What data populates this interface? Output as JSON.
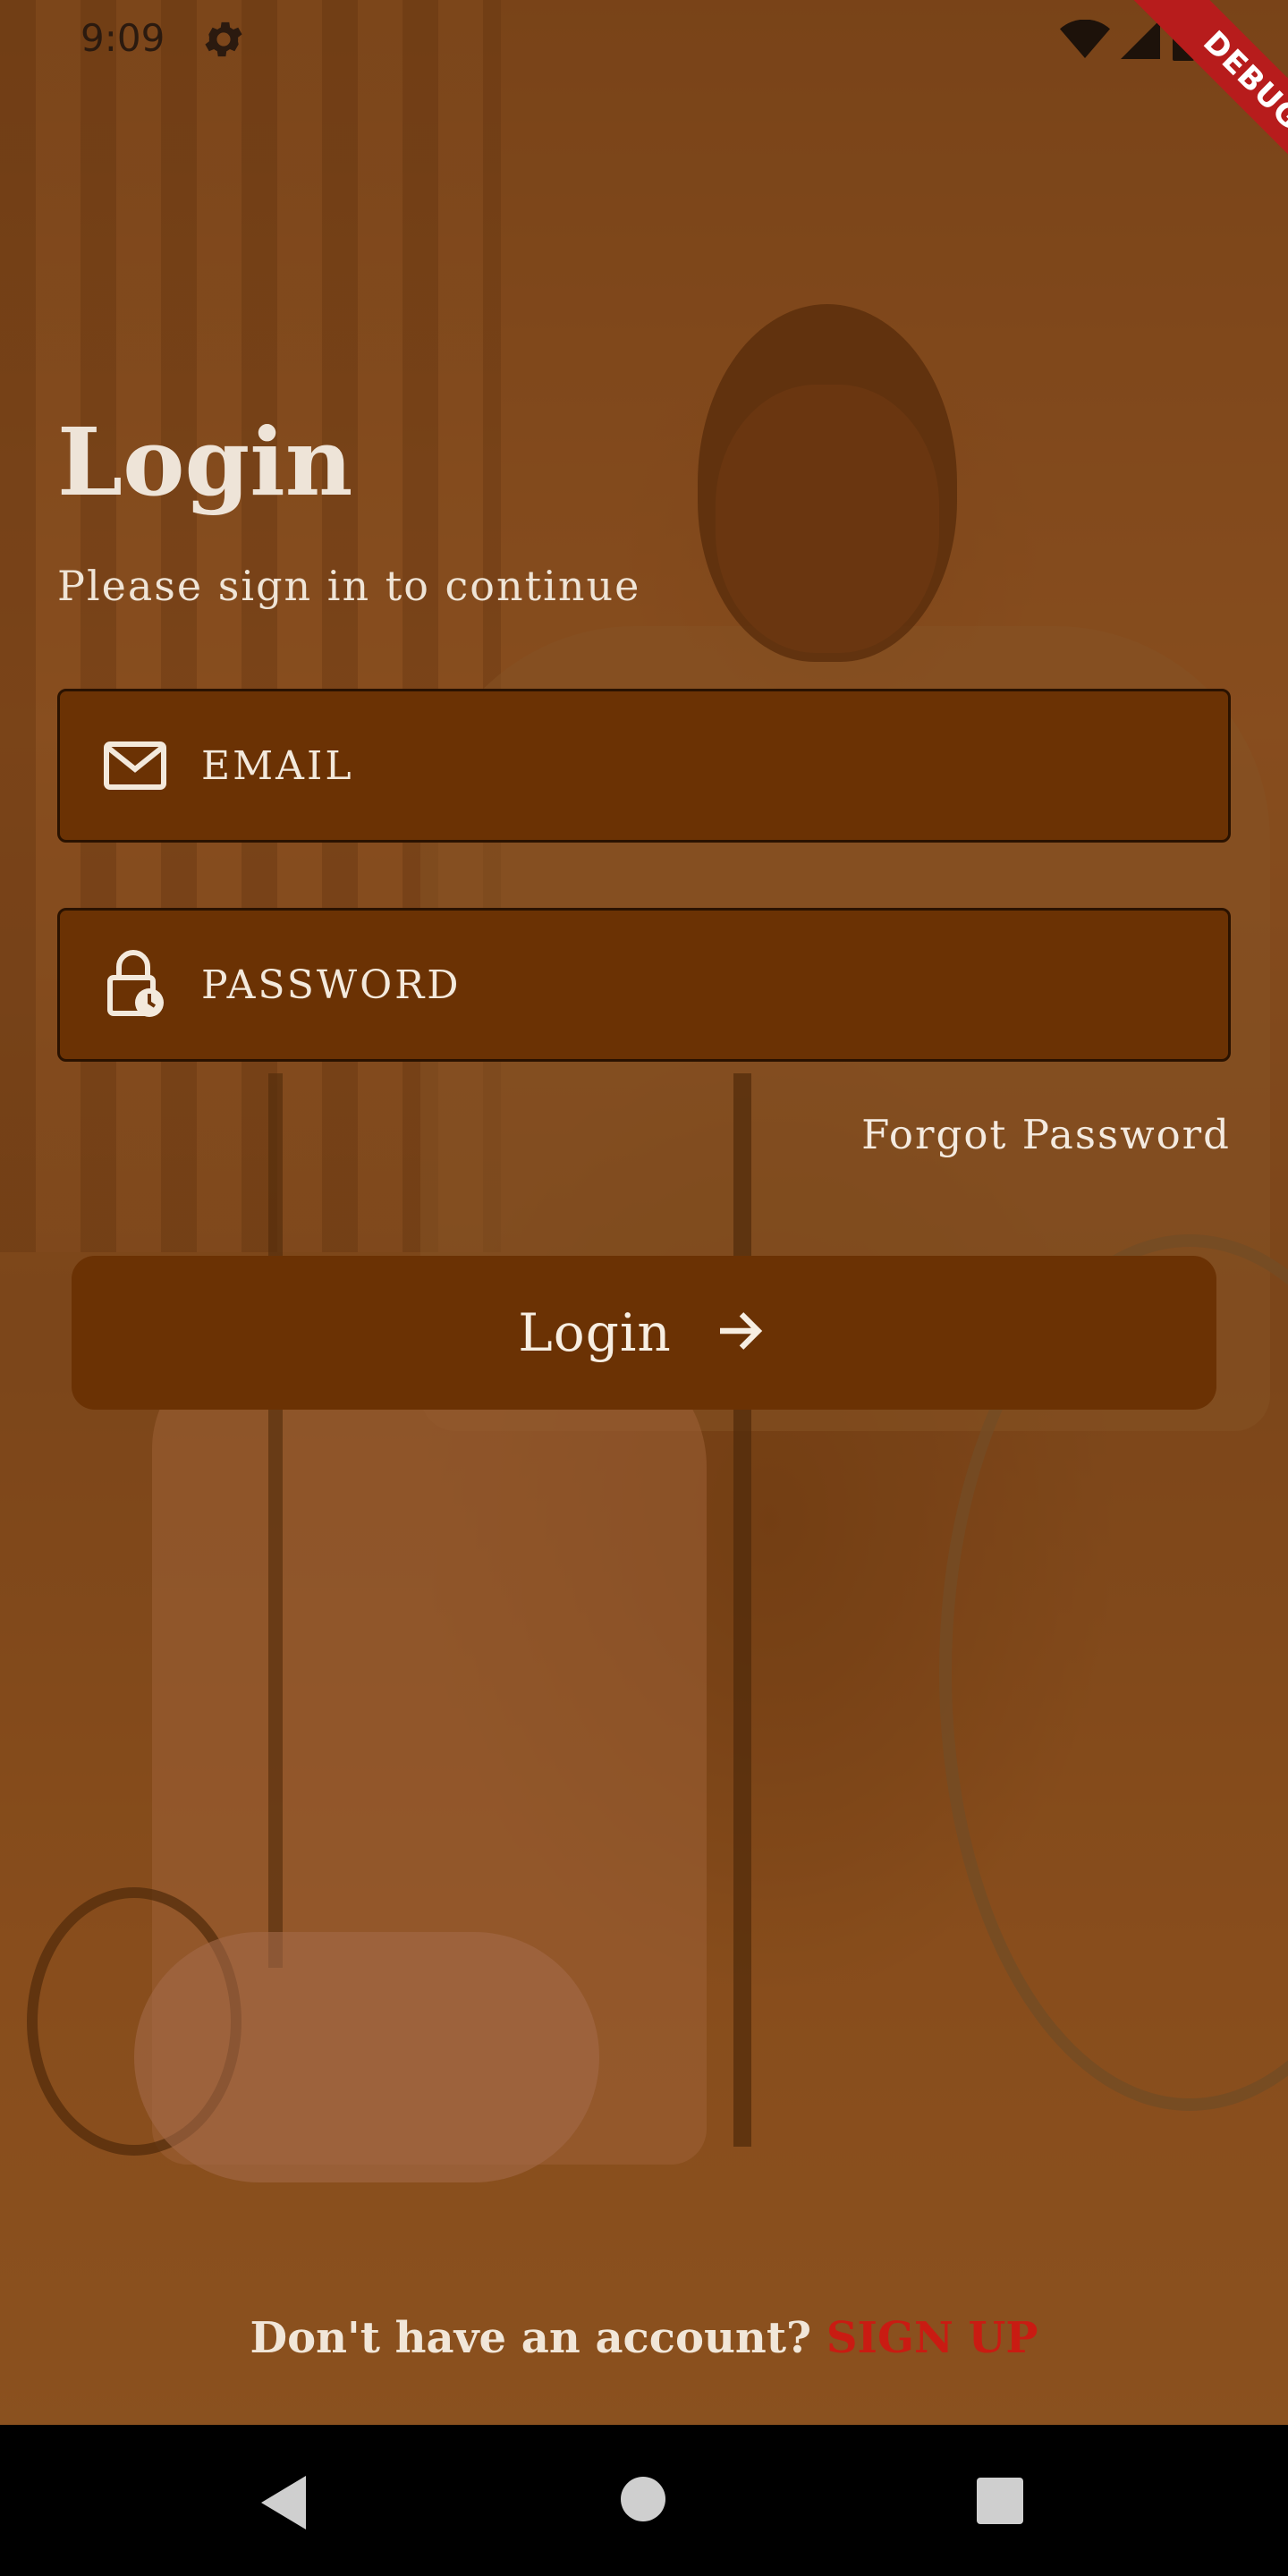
{
  "status_bar": {
    "time": "9:09",
    "icons": [
      "gear-icon",
      "wifi-icon",
      "signal-icon",
      "battery-icon"
    ],
    "debug_banner": "DEBUG"
  },
  "login": {
    "title": "Login",
    "subtitle": "Please sign in to continue",
    "email_placeholder": "EMAIL",
    "password_placeholder": "PASSWORD",
    "forgot_password": "Forgot Password",
    "login_button": "Login"
  },
  "signup": {
    "prompt": "Don't have an account?",
    "link": "SIGN UP"
  },
  "colors": {
    "field_bg": "#6b3204",
    "signup_link": "#c91b12",
    "debug_banner": "#b71c1c"
  },
  "nav_bar": {
    "icons": [
      "back-icon",
      "home-icon",
      "recents-icon"
    ]
  }
}
